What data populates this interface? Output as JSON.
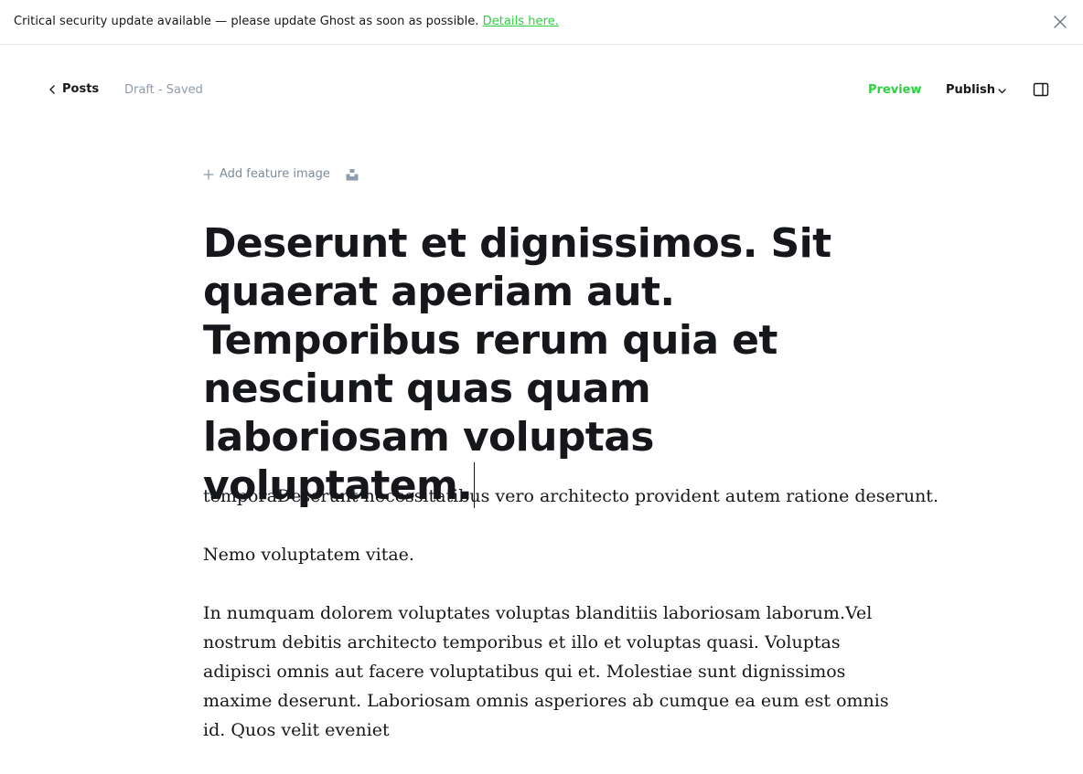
{
  "banner": {
    "message": "Critical security update available — please update Ghost as soon as possible.",
    "link_label": "Details here."
  },
  "topbar": {
    "back_label": "Posts",
    "status": "Draft - Saved",
    "preview_label": "Preview",
    "publish_label": "Publish"
  },
  "editor": {
    "feature_image_label": "Add feature image",
    "title": "Deserunt et dignissimos. Sit quaerat aperiam aut. Temporibus rerum quia et nesciunt quas quam laboriosam voluptas voluptatem.",
    "paragraphs": [
      "temporaDeserunt necessitatibus vero architecto provident autem ratione deserunt.",
      "Nemo voluptatem vitae.",
      "In numquam dolorem voluptates voluptas blanditiis laboriosam laborum.Vel nostrum debitis architecto temporibus et illo et voluptas quasi. Voluptas adipisci omnis aut facere voluptatibus qui et. Molestiae sunt dignissimos maxime deserunt. Laboriosam omnis asperiores ab cumque ea eum est omnis id. Quos velit eveniet"
    ]
  },
  "icons": {
    "close": "close-icon",
    "back": "chevron-left-icon",
    "publish_caret": "chevron-down-icon",
    "sidebar": "sidebar-panel-icon",
    "plus": "plus-icon",
    "unsplash": "unsplash-icon"
  },
  "colors": {
    "accent_green": "#30cf43",
    "muted_text": "#8e9cac",
    "text": "#15171a"
  }
}
